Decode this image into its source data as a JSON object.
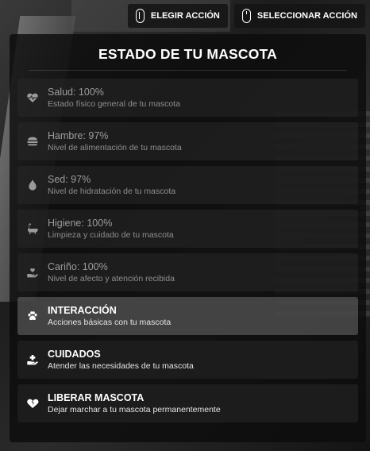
{
  "topbar": {
    "choose_action": "ELEGIR ACCIÓN",
    "select_action": "SELECCIONAR ACCIÓN"
  },
  "panel": {
    "title": "ESTADO DE TU MASCOTA",
    "stats": [
      {
        "label": "Salud: 100%",
        "desc": "Estado físico general de tu mascota",
        "icon": "heart-pulse-icon"
      },
      {
        "label": "Hambre: 97%",
        "desc": "Nivel de alimentación de tu mascota",
        "icon": "burger-icon"
      },
      {
        "label": "Sed: 97%",
        "desc": "Nivel de hidratación de tu mascota",
        "icon": "droplet-icon"
      },
      {
        "label": "Higiene: 100%",
        "desc": "Limpieza y cuidado de tu mascota",
        "icon": "bathtub-icon"
      },
      {
        "label": "Cariño: 100%",
        "desc": "Nivel de afecto y atención recibida",
        "icon": "hand-heart-icon"
      }
    ],
    "actions": [
      {
        "label": "INTERACCIÓN",
        "desc": "Acciones básicas con tu mascota",
        "icon": "paw-icon",
        "highlighted": true
      },
      {
        "label": "CUIDADOS",
        "desc": "Atender las necesidades de tu mascota",
        "icon": "hand-holding-medical-icon"
      },
      {
        "label": "LIBERAR MASCOTA",
        "desc": "Dejar marchar a tu mascota permanentemente",
        "icon": "heart-crack-icon"
      }
    ]
  }
}
